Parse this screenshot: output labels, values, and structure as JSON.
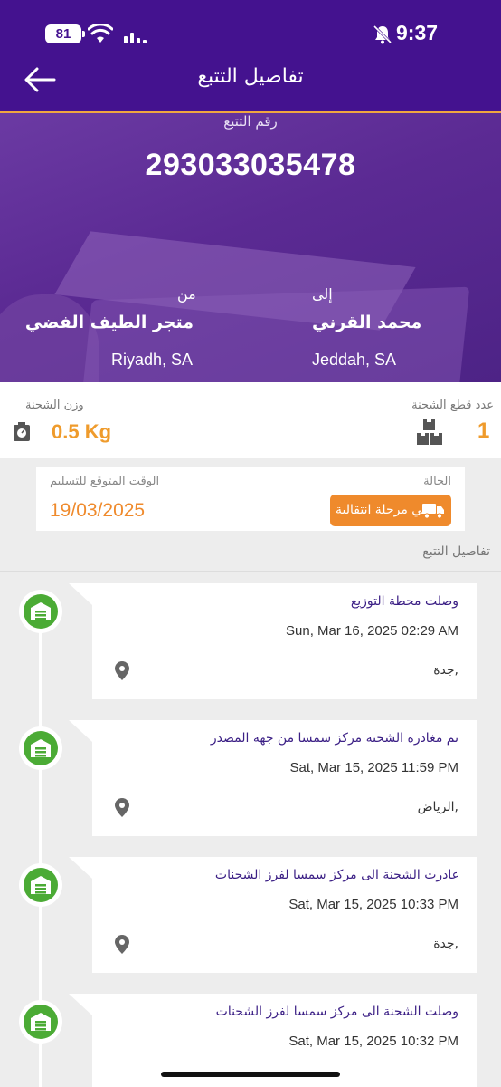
{
  "status_bar": {
    "battery": "81",
    "time": "9:37"
  },
  "header": {
    "title": "تفاصيل التتبع"
  },
  "hero": {
    "tracking_label": "رقم التتبع",
    "tracking_number": "293033035478",
    "to_label": "إلى",
    "to_name": "محمد القرني",
    "to_city": "Jeddah, SA",
    "from_label": "من",
    "from_name": "متجر الطيف الفضي",
    "from_city": "Riyadh, SA"
  },
  "info": {
    "pieces_label": "عدد قطع الشحنة",
    "pieces_value": "1",
    "weight_label": "وزن الشحنة",
    "weight_value": "0.5 Kg"
  },
  "status_card": {
    "status_label": "الحالة",
    "status_value": "في مرحلة انتقالية",
    "eta_label": "الوقت المتوقع للتسليم",
    "eta_value": "19/03/2025"
  },
  "section_title": "تفاصيل التتبع",
  "events": [
    {
      "title": "وصلت محطة التوزيع",
      "time": "Sun, Mar 16, 2025 02:29 AM",
      "city": "جدة,"
    },
    {
      "title": "تم مغادرة الشحنة مركز سمسا من جهة المصدر",
      "time": "Sat, Mar 15, 2025 11:59 PM",
      "city": "الرياض,"
    },
    {
      "title": "غادرت الشحنة الى مركز سمسا لفرز الشحنات",
      "time": "Sat, Mar 15, 2025 10:33 PM",
      "city": "جدة,"
    },
    {
      "title": "وصلت الشحنة الى مركز سمسا لفرز الشحنات",
      "time": "Sat, Mar 15, 2025 10:32 PM",
      "city": ""
    }
  ],
  "colors": {
    "brand_purple": "#44128f",
    "accent_orange": "#ef8a2c",
    "timeline_green": "#4bab35"
  },
  "icons": [
    "back-arrow-icon",
    "warehouse-icon",
    "location-pin-icon",
    "truck-icon",
    "boxes-icon",
    "scale-icon",
    "wifi-icon",
    "signal-icon",
    "bell-off-icon"
  ]
}
